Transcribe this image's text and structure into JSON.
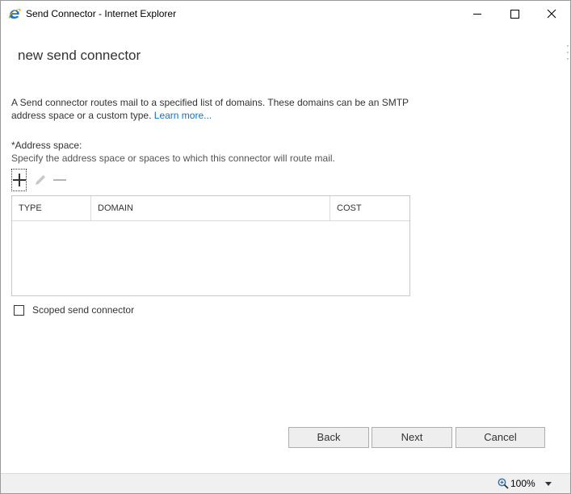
{
  "window": {
    "title": "Send Connector - Internet Explorer"
  },
  "page": {
    "title": "new send connector",
    "description": "A Send connector routes mail to a specified list of domains. These domains can be an SMTP address space or a custom type. ",
    "learn_more": "Learn more..."
  },
  "address_space": {
    "label": "*Address space:",
    "help": "Specify the address space or spaces to which this connector will route mail.",
    "columns": [
      "TYPE",
      "DOMAIN",
      "COST"
    ],
    "rows": []
  },
  "scoped": {
    "label": "Scoped send connector",
    "checked": false
  },
  "buttons": {
    "back": "Back",
    "next": "Next",
    "cancel": "Cancel"
  },
  "status": {
    "zoom": "100%"
  },
  "colors": {
    "link": "#1570c6",
    "ie_blue": "#1e73be",
    "ie_gold": "#f2b01e"
  }
}
